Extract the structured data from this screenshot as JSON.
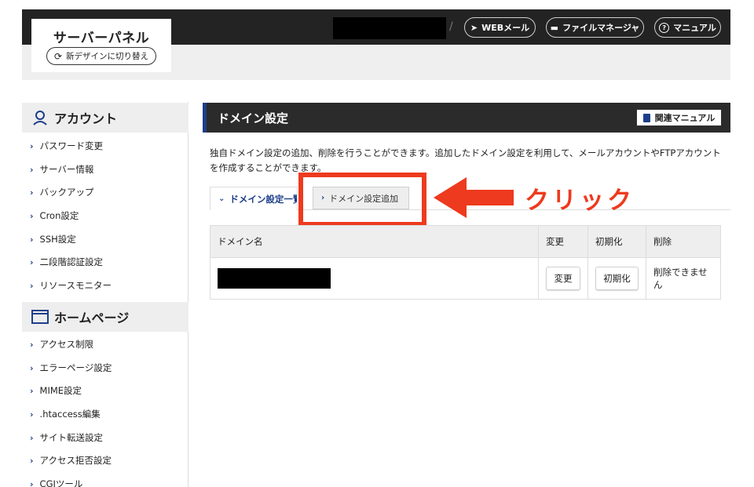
{
  "header": {
    "logo_title": "サーバーパネル",
    "switch_design_label": "新デザインに切り替え",
    "path_separator": "/",
    "webmail_label": "WEBメール",
    "file_manager_label": "ファイルマネージャ",
    "manual_label": "マニュアル"
  },
  "sidebar": {
    "account": {
      "title": "アカウント",
      "items": [
        {
          "label": "パスワード変更"
        },
        {
          "label": "サーバー情報"
        },
        {
          "label": "バックアップ"
        },
        {
          "label": "Cron設定"
        },
        {
          "label": "SSH設定"
        },
        {
          "label": "二段階認証設定"
        },
        {
          "label": "リソースモニター"
        }
      ]
    },
    "homepage": {
      "title": "ホームページ",
      "items": [
        {
          "label": "アクセス制限"
        },
        {
          "label": "エラーページ設定"
        },
        {
          "label": "MIME設定"
        },
        {
          "label": ".htaccess編集"
        },
        {
          "label": "サイト転送設定"
        },
        {
          "label": "アクセス拒否設定"
        },
        {
          "label": "CGIツール"
        }
      ]
    }
  },
  "main": {
    "title": "ドメイン設定",
    "manual_button": "関連マニュアル",
    "description": "独自ドメイン設定の追加、削除を行うことができます。追加したドメイン設定を利用して、メールアカウントやFTPアカウントを作成することができます。",
    "tabs": {
      "list": "ドメイン設定一覧",
      "add": "ドメイン設定追加"
    },
    "annotation": "クリック",
    "table": {
      "headers": [
        "ドメイン名",
        "変更",
        "初期化",
        "削除"
      ],
      "rows": [
        {
          "change_button": "変更",
          "init_button": "初期化",
          "delete_text": "削除できません"
        }
      ]
    }
  },
  "colors": {
    "accent_blue": "#1d3e8a",
    "highlight_red": "#ee3a1e",
    "header_dark": "#232323"
  }
}
